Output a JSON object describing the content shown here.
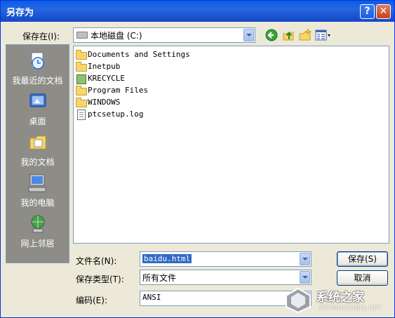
{
  "window": {
    "title": "另存为",
    "help_glyph": "?",
    "close_glyph": "✕"
  },
  "location": {
    "label": "保存在(I):",
    "value": "本地磁盘 (C:)"
  },
  "toolbar": {
    "back_icon": "back-icon",
    "up_icon": "up-folder-icon",
    "new_folder_icon": "new-folder-icon",
    "views_icon": "views-menu-icon"
  },
  "places": [
    {
      "label": "我最近的文档",
      "icon": "recent-documents-icon"
    },
    {
      "label": "桌面",
      "icon": "desktop-icon"
    },
    {
      "label": "我的文档",
      "icon": "my-documents-icon"
    },
    {
      "label": "我的电脑",
      "icon": "my-computer-icon"
    },
    {
      "label": "网上邻居",
      "icon": "network-places-icon"
    }
  ],
  "files": [
    {
      "name": "Documents and Settings",
      "type": "folder"
    },
    {
      "name": "Inetpub",
      "type": "folder"
    },
    {
      "name": "KRECYCLE",
      "type": "recycle"
    },
    {
      "name": "Program Files",
      "type": "folder"
    },
    {
      "name": "WINDOWS",
      "type": "folder"
    },
    {
      "name": "ptcsetup.log",
      "type": "file"
    }
  ],
  "form": {
    "filename_label": "文件名(N):",
    "filename_value": "baidu.html",
    "filetype_label": "保存类型(T):",
    "filetype_value": "所有文件",
    "encoding_label": "编码(E):",
    "encoding_value": "ANSI"
  },
  "buttons": {
    "save": "保存(S)",
    "cancel": "取消"
  },
  "watermark": {
    "text": "系统之家",
    "subtext": "XITONGZHIJIA.NET"
  },
  "colors": {
    "title_bar": "#1c55d4",
    "selection": "#316ac5",
    "places_bar": "#8d8c87"
  }
}
